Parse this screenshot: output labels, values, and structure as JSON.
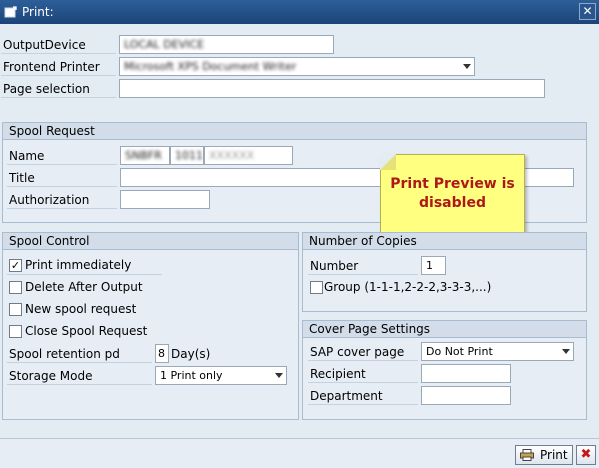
{
  "window": {
    "title": "Print:",
    "close_glyph": "✕"
  },
  "output": {
    "device_label": "OutputDevice",
    "device_value": "LOCAL DEVICE",
    "frontend_label": "Frontend Printer",
    "frontend_value": "Microsoft XPS Document Writer",
    "page_selection_label": "Page selection",
    "page_selection_value": ""
  },
  "spool_request": {
    "title": "Spool Request",
    "name_label": "Name",
    "name_part1": "SNBFR",
    "name_part2": "1011",
    "name_part3": "XXXXXX",
    "title_label": "Title",
    "title_value": "",
    "authorization_label": "Authorization",
    "authorization_value": ""
  },
  "note": {
    "text": "Print Preview is disabled"
  },
  "spool_control": {
    "title": "Spool Control",
    "print_immediately": {
      "label": "Print immediately",
      "checked": true
    },
    "delete_after_output": {
      "label": "Delete After Output",
      "checked": false
    },
    "new_spool_request": {
      "label": "New spool request",
      "checked": false
    },
    "close_spool_request": {
      "label": "Close Spool Request",
      "checked": false
    },
    "retention_label": "Spool retention pd",
    "retention_value": "8",
    "retention_unit": "Day(s)",
    "storage_label": "Storage Mode",
    "storage_value": "1 Print only"
  },
  "copies": {
    "title": "Number of Copies",
    "number_label": "Number",
    "number_value": "1",
    "group_label": "Group (1-1-1,2-2-2,3-3-3,...)",
    "group_checked": false
  },
  "cover_page": {
    "title": "Cover Page Settings",
    "sap_cover_label": "SAP cover page",
    "sap_cover_value": "Do Not Print",
    "recipient_label": "Recipient",
    "recipient_value": "",
    "department_label": "Department",
    "department_value": ""
  },
  "buttons": {
    "print_label": "Print",
    "cancel_glyph": "✖"
  }
}
